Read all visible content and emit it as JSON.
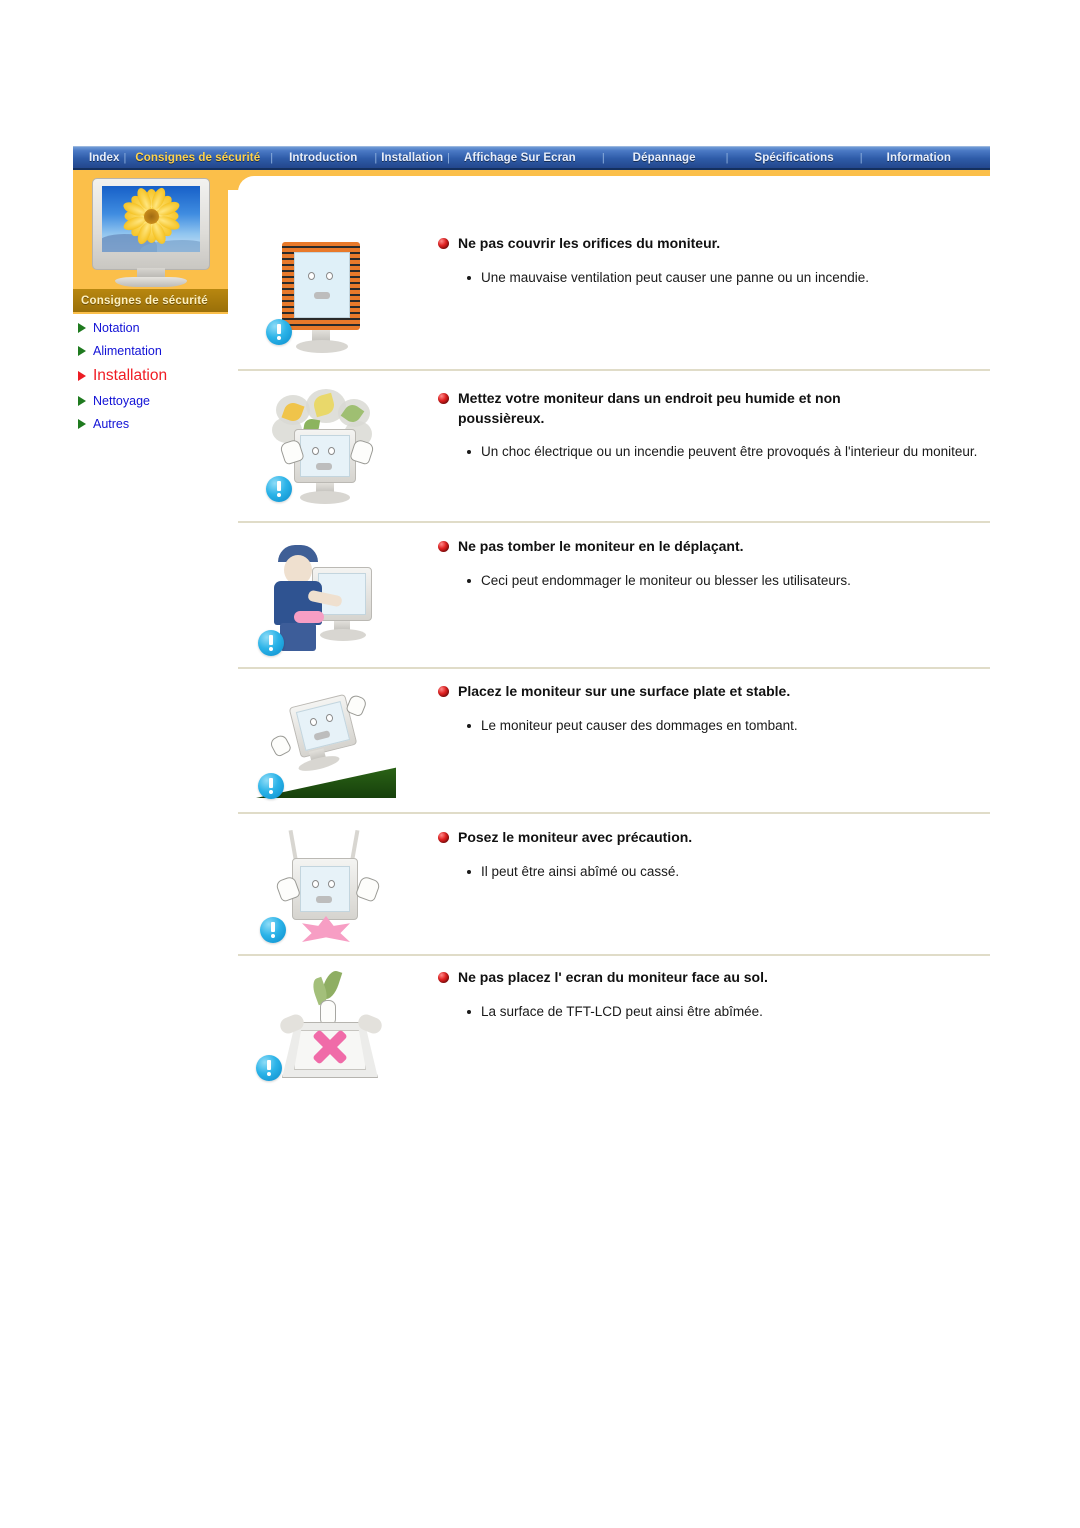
{
  "nav": {
    "items": [
      {
        "label": "Index",
        "active": false
      },
      {
        "label": "Consignes de sécurité",
        "active": true
      },
      {
        "label": "Introduction",
        "active": false
      },
      {
        "label": "Installation",
        "active": false
      },
      {
        "label": "Affichage Sur Ecran",
        "active": false
      },
      {
        "label": "Dépannage",
        "active": false
      },
      {
        "label": "Spécifications",
        "active": false
      },
      {
        "label": "Information",
        "active": false
      }
    ],
    "separator": "|"
  },
  "sidebar": {
    "thumb_caption": "Consignes de sécurité",
    "thumbnail_icon": "monitor-sunflower-image",
    "items": [
      {
        "label": "Notation",
        "active": false
      },
      {
        "label": "Alimentation",
        "active": false
      },
      {
        "label": "Installation",
        "active": true
      },
      {
        "label": "Nettoyage",
        "active": false
      },
      {
        "label": "Autres",
        "active": false
      }
    ]
  },
  "colors": {
    "nav_bg": "#2e5ba8",
    "nav_active_text": "#ffd24a",
    "panel_orange": "#fbbf4a",
    "caption_gold": "#b8870f",
    "link_blue": "#1212d6",
    "active_red": "#f01c24",
    "triangle_green": "#1f7a1f",
    "divider": "#e0dcc8",
    "warn_blue": "#2bb3e8",
    "heading_ball_red": "#e02020"
  },
  "sections": [
    {
      "id": "no-cover-vents",
      "heading": "Ne pas couvrir les orifices du moniteur.",
      "bullets": [
        "Une mauvaise ventilation peut causer une panne ou un incendie."
      ],
      "illustration": "monitor-with-vents-icon",
      "badge": "warning-exclamation-icon"
    },
    {
      "id": "low-humidity-dust-free",
      "heading": "Mettez votre moniteur dans un endroit peu humide et non poussièreux.",
      "bullets": [
        "Un choc électrique ou un incendie peuvent être provoqués à l'interieur du moniteur."
      ],
      "illustration": "dusty-monitor-icon",
      "badge": "warning-exclamation-icon"
    },
    {
      "id": "do-not-drop",
      "heading": "Ne pas tomber le moniteur en le déplaçant.",
      "bullets": [
        "Ceci peut endommager le moniteur ou blesser les utilisateurs."
      ],
      "illustration": "person-carrying-monitor-icon",
      "badge": "warning-exclamation-icon"
    },
    {
      "id": "flat-stable-surface",
      "heading": "Placez le moniteur sur une surface plate et stable.",
      "bullets": [
        "Le moniteur peut causer des dommages en tombant."
      ],
      "illustration": "monitor-on-slope-icon",
      "badge": "warning-exclamation-icon"
    },
    {
      "id": "set-down-carefully",
      "heading": "Posez le moniteur avec précaution.",
      "bullets": [
        "Il peut être ainsi abîmé ou cassé."
      ],
      "illustration": "monitor-dropped-icon",
      "badge": "warning-exclamation-icon"
    },
    {
      "id": "no-face-down",
      "heading": "Ne pas placez l' ecran du moniteur face au sol.",
      "bullets": [
        "La surface de TFT-LCD peut ainsi être abîmée."
      ],
      "illustration": "monitor-face-down-x-icon",
      "badge": "warning-exclamation-icon"
    }
  ]
}
